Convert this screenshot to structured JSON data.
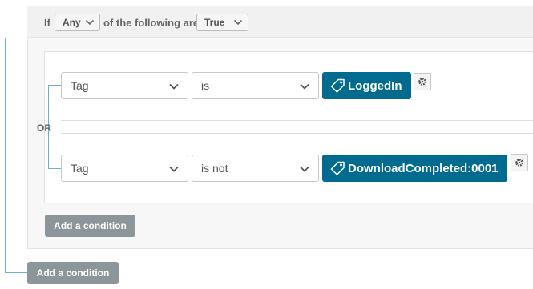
{
  "header": {
    "if_label": "If",
    "match_select": "Any",
    "middle_label": "of the following are",
    "truth_select": "True"
  },
  "or_label": "OR",
  "conditions": [
    {
      "field": "Tag",
      "operator": "is",
      "tag": "LoggedIn"
    },
    {
      "field": "Tag",
      "operator": "is not",
      "tag": "DownloadCompleted:0001"
    }
  ],
  "inner_add_label": "Add a condition",
  "outer_add_label": "Add a condition",
  "colors": {
    "accent": "#006b8f",
    "connector": "#6fb1cc",
    "button_gray": "#8c9599"
  },
  "icons": [
    "chevron-down-icon",
    "tag-icon",
    "gear-icon"
  ]
}
